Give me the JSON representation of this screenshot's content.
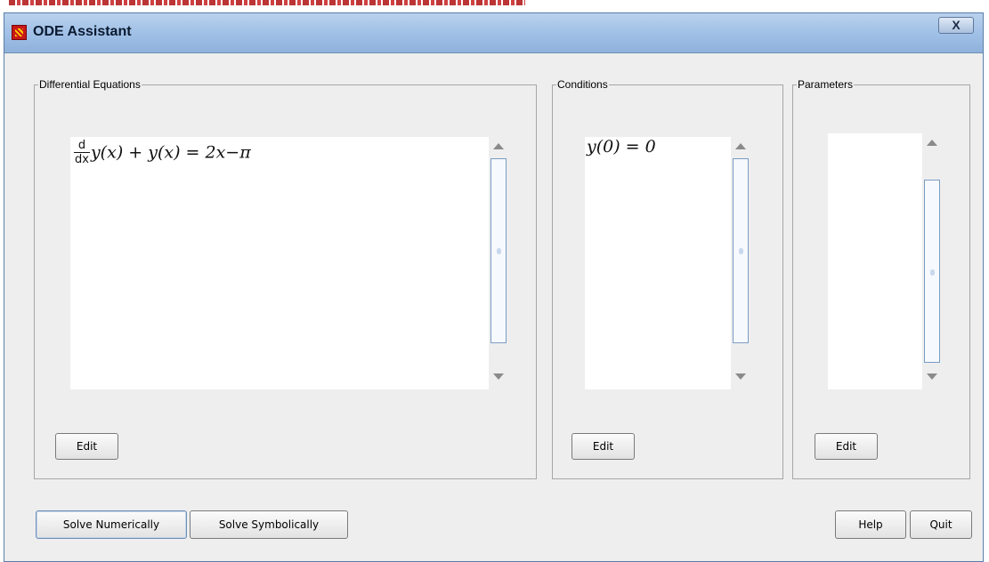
{
  "window": {
    "title": "ODE Assistant",
    "close_label": "X"
  },
  "differential_equations": {
    "label": "Differential Equations",
    "equation": {
      "deriv_num": "d",
      "deriv_den": "dx",
      "body": "y(x) + y(x) = 2x−π"
    },
    "edit_label": "Edit"
  },
  "conditions": {
    "label": "Conditions",
    "condition": "y(0) = 0",
    "edit_label": "Edit"
  },
  "parameters": {
    "label": "Parameters",
    "edit_label": "Edit"
  },
  "buttons": {
    "solve_numerically": "Solve Numerically",
    "solve_symbolically": "Solve Symbolically",
    "help": "Help",
    "quit": "Quit"
  },
  "icons": {
    "app_logo": "maple-leaf-icon",
    "close": "close-icon",
    "scroll_up": "scroll-up-arrow-icon",
    "scroll_down": "scroll-down-arrow-icon"
  },
  "colors": {
    "titlebar": "#9fbfe6",
    "window_bg": "#eeeeee",
    "thumb_border": "#7a9cc4"
  }
}
